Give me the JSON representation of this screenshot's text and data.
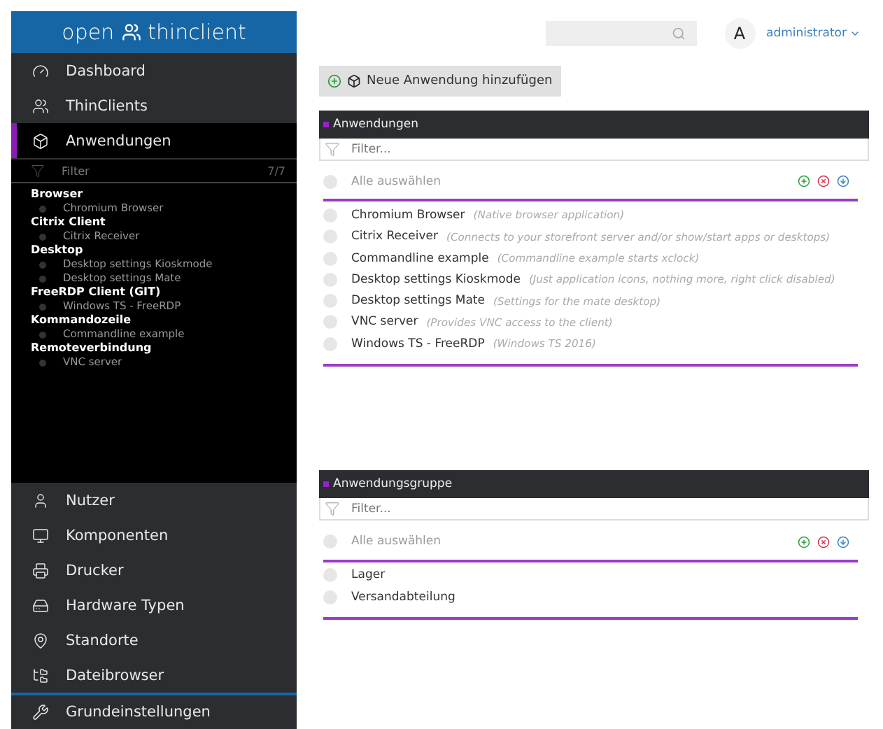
{
  "logo": {
    "left": "open",
    "right": "thinclient"
  },
  "nav_top": [
    {
      "label": "Dashboard",
      "selected": false
    },
    {
      "label": "ThinClients",
      "selected": false
    },
    {
      "label": "Anwendungen",
      "selected": true
    }
  ],
  "sidebar_filter": {
    "placeholder": "Filter",
    "count": "7/7"
  },
  "tree": [
    {
      "label": "Browser",
      "children": [
        {
          "label": "Chromium Browser"
        }
      ]
    },
    {
      "label": "Citrix Client",
      "children": [
        {
          "label": "Citrix Receiver"
        }
      ]
    },
    {
      "label": "Desktop",
      "children": [
        {
          "label": "Desktop settings Kioskmode"
        },
        {
          "label": "Desktop settings Mate"
        }
      ]
    },
    {
      "label": "FreeRDP Client (GIT)",
      "children": [
        {
          "label": "Windows TS - FreeRDP"
        }
      ]
    },
    {
      "label": "Kommandozeile",
      "children": [
        {
          "label": "Commandline example"
        }
      ]
    },
    {
      "label": "Remoteverbindung",
      "children": [
        {
          "label": "VNC server"
        }
      ]
    }
  ],
  "nav_bottom": [
    {
      "label": "Nutzer",
      "selected": false
    },
    {
      "label": "Komponenten",
      "selected": false
    },
    {
      "label": "Drucker",
      "selected": false
    },
    {
      "label": "Hardware Typen",
      "selected": false
    },
    {
      "label": "Standorte",
      "selected": false
    },
    {
      "label": "Dateibrowser",
      "selected": false
    }
  ],
  "settings": {
    "label": "Grundeinstellungen",
    "selected": false
  },
  "header": {
    "avatar": "A",
    "user": "administrator"
  },
  "add_button": "Neue Anwendung hinzufügen",
  "panels": [
    {
      "title": "Anwendungen",
      "filter_placeholder": "Filter...",
      "select_all": {
        "label": "Alle auswählen",
        "checked": false
      },
      "items": [
        {
          "name": "Chromium Browser",
          "description": "(Native browser application)",
          "checked": false
        },
        {
          "name": "Citrix Receiver",
          "description": "(Connects to your storefront server and/or show/start apps or desktops)",
          "checked": false
        },
        {
          "name": "Commandline example",
          "description": "(Commandline example starts xclock)",
          "checked": false
        },
        {
          "name": "Desktop settings Kioskmode",
          "description": "(Just application icons, nothing more, right click disabled)",
          "checked": false
        },
        {
          "name": "Desktop settings Mate",
          "description": "(Settings for the mate desktop)",
          "checked": false
        },
        {
          "name": "VNC server",
          "description": "(Provides VNC access to the client)",
          "checked": false
        },
        {
          "name": "Windows TS - FreeRDP",
          "description": "(Windows TS 2016)",
          "checked": false
        }
      ]
    },
    {
      "title": "Anwendungsgruppe",
      "filter_placeholder": "Filter...",
      "select_all": {
        "label": "Alle auswählen",
        "checked": false
      },
      "items": [
        {
          "name": "Lager",
          "checked": false
        },
        {
          "name": "Versandabteilung",
          "checked": false
        }
      ]
    }
  ]
}
